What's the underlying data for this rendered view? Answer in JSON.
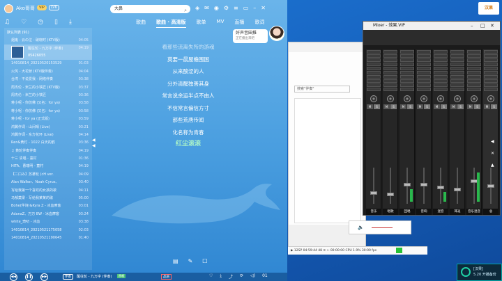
{
  "player": {
    "user_name": "Ako哥哥",
    "vip": "VIP",
    "level": "LV6",
    "search_value": "大鼻",
    "playlist_title": "默认列表 (91)",
    "playlist": [
      {
        "title": "烟鬼 - 云の泣 - 破晓时 (KTV版)",
        "dur": "04:05"
      },
      {
        "title": "醒往轮 - 九万字 (伴奏)",
        "sub": "05426055",
        "dur": "04:19",
        "current": true
      },
      {
        "title": "14010814_20210520153529",
        "dur": "01:03"
      },
      {
        "title": "火风 - 大花轿 (KTV版伴奏)",
        "dur": "04:04"
      },
      {
        "title": "台湾 - 不说爱我 - 网络伴奏",
        "dur": "03:38"
      },
      {
        "title": "周杰伦 - 米兰的小铁匠 (KTV版)",
        "dur": "03:37"
      },
      {
        "title": "周杰伦 - 米兰的小铁匠",
        "dur": "03:36"
      },
      {
        "title": "蒋小呢 - 你仿佛 (又名：for ya)",
        "dur": "03:58"
      },
      {
        "title": "蒋小呢 - 你仿佛 (又名：for ya)",
        "dur": "03:58"
      },
      {
        "title": "蒋小呢 - for ya (正式版)",
        "dur": "03:59"
      },
      {
        "title": "鸿翼作词 - 山间晴 (Live)",
        "dur": "03:21"
      },
      {
        "title": "鸿翼作词 - 东方花环 (Live)",
        "dur": "04:14"
      },
      {
        "title": "Ren&黄灯 - 1022 白天的鹤",
        "dur": "03:36"
      },
      {
        "title": "♫ 黄轮伴奏伴奏",
        "dur": "04:19"
      },
      {
        "title": "十三 清唱 - 童村",
        "dur": "01:36"
      },
      {
        "title": "HITA、曹瑞明 - 童村",
        "dur": "04:19"
      },
      {
        "title": "【二口み】苏慕轮 (cH ver.",
        "dur": "04:09"
      },
      {
        "title": "Alan Walker、Noah Cyrus、",
        "dur": "03:40"
      },
      {
        "title": "写给我第一个喜欢的女孩的歌",
        "dur": "04:11"
      },
      {
        "title": "马郁莫梁 - 写给我某某的歌",
        "dur": "05:00"
      },
      {
        "title": "Bohe(伴诗)&Kyra Z - 冰血摩客",
        "dur": "03:01"
      },
      {
        "title": "AdanaZ、万万 BW - 冰血摩客",
        "dur": "03:24"
      },
      {
        "title": "white_琦叨 - 冰血",
        "dur": "03:38"
      },
      {
        "title": "14010814_20210521175058",
        "dur": "02:03"
      },
      {
        "title": "14010814_20210521190645",
        "dur": "01:40"
      }
    ],
    "tabs": [
      {
        "label": "歌曲",
        "active": false
      },
      {
        "label": "歌曲 · 高清版",
        "active": true
      },
      {
        "label": "歌单",
        "active": false
      },
      {
        "label": "MV",
        "active": false
      },
      {
        "label": "直播",
        "active": false
      },
      {
        "label": "歌词",
        "active": false
      }
    ],
    "recommend_title": "好声音田推",
    "recommend_sub": "正在播出来吧",
    "lyrics": [
      {
        "text": "看那些流离失所的游魂",
        "cls": "dim"
      },
      {
        "text": "莫要一晨屋檐围困",
        "cls": ""
      },
      {
        "text": "从来酸涩的人",
        "cls": ""
      },
      {
        "text": "分外清醒独善其身",
        "cls": ""
      },
      {
        "text": "常言说余运半点不由人",
        "cls": ""
      },
      {
        "text": "不信常言偏信方寸",
        "cls": ""
      },
      {
        "text": "那些荒唐传闻",
        "cls": ""
      },
      {
        "text": "化名称为青春",
        "cls": ""
      },
      {
        "text": "红尘滚滚",
        "cls": "now"
      }
    ],
    "bottom_mode": "伴奏",
    "bottom_title": "醒往轮 - 九万字 (伴奏)",
    "bottom_hq": "原唱",
    "bottom_quality": "品质",
    "bottom_time": "01"
  },
  "docs": {
    "search_placeholder": "搜索\"伴奏\"",
    "statusbar": "▶ 12SP  04:59:44    48 ≋ ⇦ 00:00:00      CPU  1.9%  30:00 fps",
    "status_green_text": "00:00"
  },
  "mixer": {
    "title": "Mixer - 效果.VIP",
    "strips": [
      {
        "label": "音乐",
        "fader": 0.3,
        "meter": 0.0
      },
      {
        "label": "唱歌",
        "fader": 0.25,
        "meter": 0.0
      },
      {
        "label": "回唱",
        "fader": 0.55,
        "meter": 0.15
      },
      {
        "label": "音响",
        "fader": 0.55,
        "meter": 0.0
      },
      {
        "label": "混音",
        "fader": 0.45,
        "meter": 0.12
      },
      {
        "label": "耳返",
        "fader": 0.4,
        "meter": 0.0
      },
      {
        "label": "音乐混音",
        "fader": 0.65,
        "meter": 0.35
      },
      {
        "label": "总",
        "fader": 0.5,
        "meter": 0.0
      }
    ],
    "ms_labels": [
      "M",
      "S"
    ]
  },
  "tray": {
    "title": "[汉果]",
    "sub": "5.20  开播备份"
  },
  "desktop_logo": "汉果",
  "colors": {
    "accent": "#1fd1a5",
    "lyric_now": "#aaf3c9"
  }
}
